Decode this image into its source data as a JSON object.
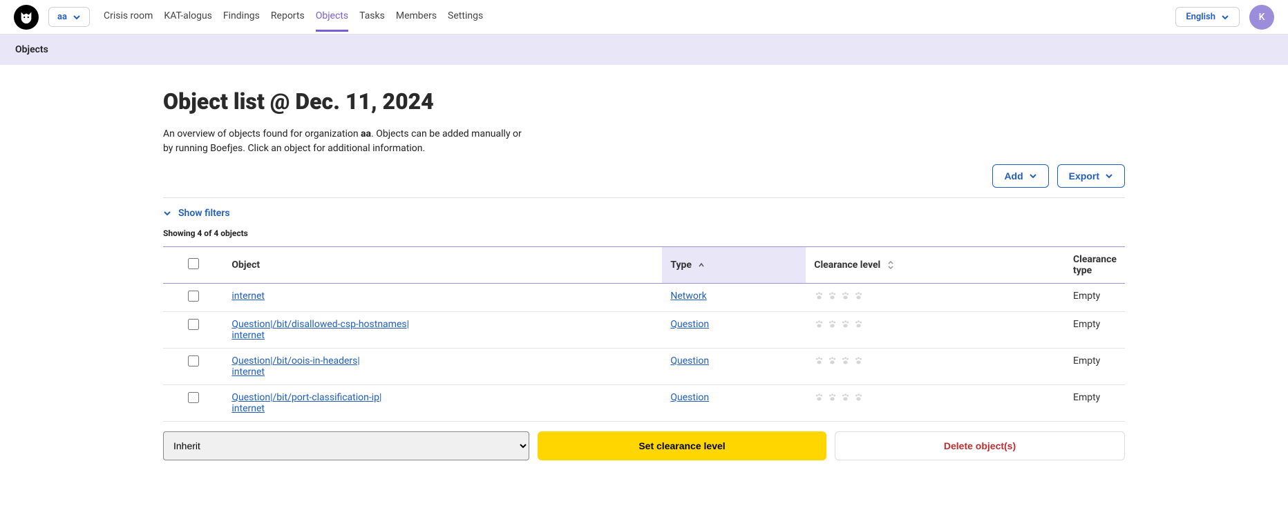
{
  "header": {
    "org": "aa",
    "nav": [
      {
        "label": "Crisis room",
        "active": false
      },
      {
        "label": "KAT-alogus",
        "active": false
      },
      {
        "label": "Findings",
        "active": false
      },
      {
        "label": "Reports",
        "active": false
      },
      {
        "label": "Objects",
        "active": true
      },
      {
        "label": "Tasks",
        "active": false
      },
      {
        "label": "Members",
        "active": false
      },
      {
        "label": "Settings",
        "active": false
      }
    ],
    "language": "English",
    "avatar_initial": "K"
  },
  "breadcrumb": "Objects",
  "page": {
    "title": "Object list @ Dec. 11, 2024",
    "subtitle_pre": "An overview of objects found for organization ",
    "subtitle_org": "aa",
    "subtitle_post": ". Objects can be added manually or by running Boefjes. Click an object for additional information."
  },
  "actions": {
    "add": "Add",
    "export": "Export"
  },
  "filters": {
    "toggle": "Show filters"
  },
  "count_text": "Showing 4 of 4 objects",
  "table": {
    "headers": {
      "object": "Object",
      "type": "Type",
      "clearance_level": "Clearance level",
      "clearance_type": "Clearance type"
    },
    "rows": [
      {
        "object": "internet",
        "type": "Network",
        "clearance_type": "Empty"
      },
      {
        "object": "Question|/bit/disallowed-csp-hostnames|internet",
        "object2": "",
        "type": "Question",
        "clearance_type": "Empty"
      },
      {
        "object": "Question|/bit/oois-in-headers|internet",
        "type": "Question",
        "clearance_type": "Empty"
      },
      {
        "object": "Question|/bit/port-classification-ip|internet",
        "type": "Question",
        "clearance_type": "Empty"
      }
    ]
  },
  "bottom": {
    "select_value": "Inherit",
    "set_clearance": "Set clearance level",
    "delete": "Delete object(s)"
  }
}
